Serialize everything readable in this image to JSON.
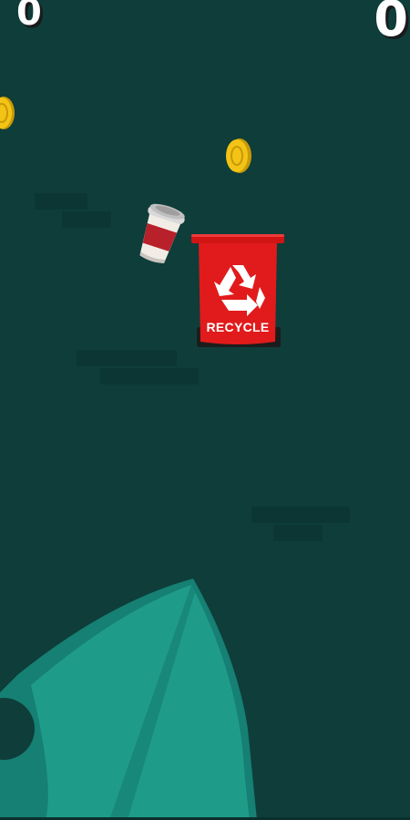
{
  "hud": {
    "score_left": "0",
    "score_right": "0"
  },
  "bin": {
    "label": "RECYCLE",
    "color": "#e11b1b",
    "icon": "recycle-icon"
  },
  "items": {
    "cup_icon": "coffee-cup-icon",
    "coin_icon": "gold-coin-icon"
  },
  "colors": {
    "background": "#0e3d3a",
    "leaf": "#1f9b8a",
    "coin": "#f3c316"
  }
}
